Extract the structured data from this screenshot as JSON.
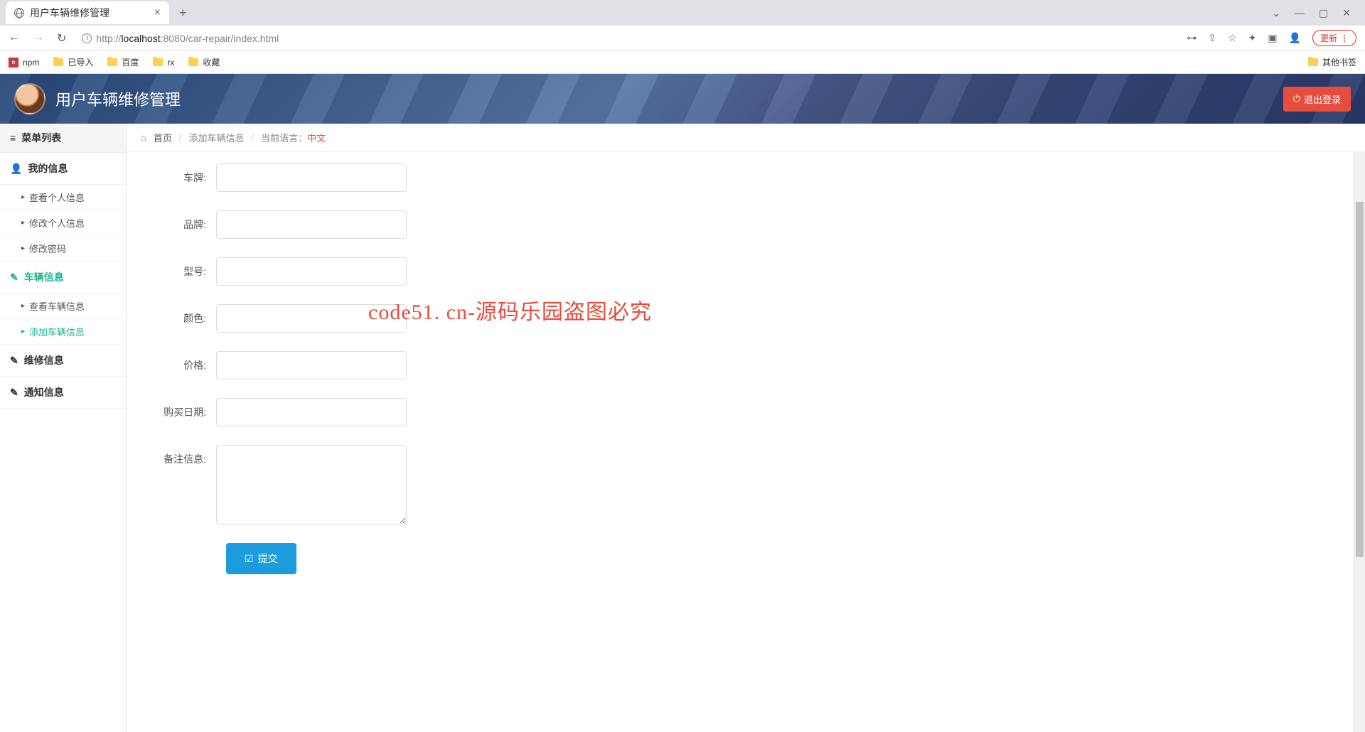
{
  "browser": {
    "tab_title": "用户车辆维修管理",
    "url_prefix": "http://",
    "url_host": "localhost",
    "url_port": ":8080",
    "url_path": "/car-repair/index.html",
    "update_label": "更新",
    "bookmarks": [
      "npm",
      "已导入",
      "百度",
      "rx",
      "收藏"
    ],
    "other_bookmarks": "其他书签"
  },
  "header": {
    "title": "用户车辆维修管理",
    "logout": "退出登录"
  },
  "sidebar": {
    "menu_title": "菜单列表",
    "sections": [
      {
        "label": "我的信息",
        "items": [
          "查看个人信息",
          "修改个人信息",
          "修改密码"
        ]
      },
      {
        "label": "车辆信息",
        "items": [
          "查看车辆信息",
          "添加车辆信息"
        ]
      },
      {
        "label": "维修信息",
        "items": []
      },
      {
        "label": "通知信息",
        "items": []
      }
    ]
  },
  "breadcrumb": {
    "home": "首页",
    "page": "添加车辆信息",
    "lang_label": "当前语言：",
    "lang_value": "中文"
  },
  "form": {
    "fields": {
      "plate": "车牌:",
      "brand": "品牌:",
      "model": "型号:",
      "color": "颜色:",
      "price": "价格:",
      "buydate": "购买日期:",
      "remark": "备注信息:"
    },
    "submit": "提交"
  },
  "watermark": "code51. cn-源码乐园盗图必究"
}
